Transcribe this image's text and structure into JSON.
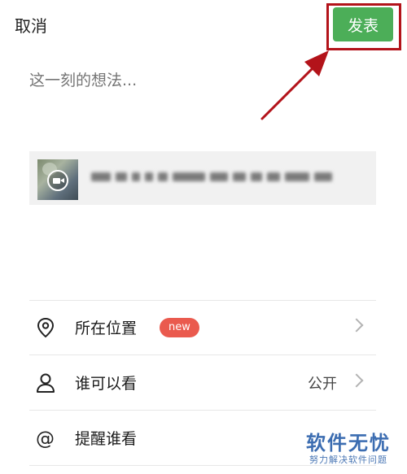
{
  "header": {
    "cancel_label": "取消",
    "publish_label": "发表",
    "publish_color": "#4cae58",
    "highlight_color": "#b3131a"
  },
  "composer": {
    "placeholder": "这一刻的想法..."
  },
  "shared_card": {
    "thumbnail_icon": "video-camera-icon"
  },
  "options": [
    {
      "icon": "location-pin-icon",
      "label": "所在位置",
      "badge": "new",
      "value": ""
    },
    {
      "icon": "person-icon",
      "label": "谁可以看",
      "badge": "",
      "value": "公开"
    },
    {
      "icon": "at-sign-icon",
      "label": "提醒谁看",
      "badge": "",
      "value": ""
    }
  ],
  "watermark": {
    "title": "软件无忧",
    "subtitle": "努力解决软件问题"
  }
}
